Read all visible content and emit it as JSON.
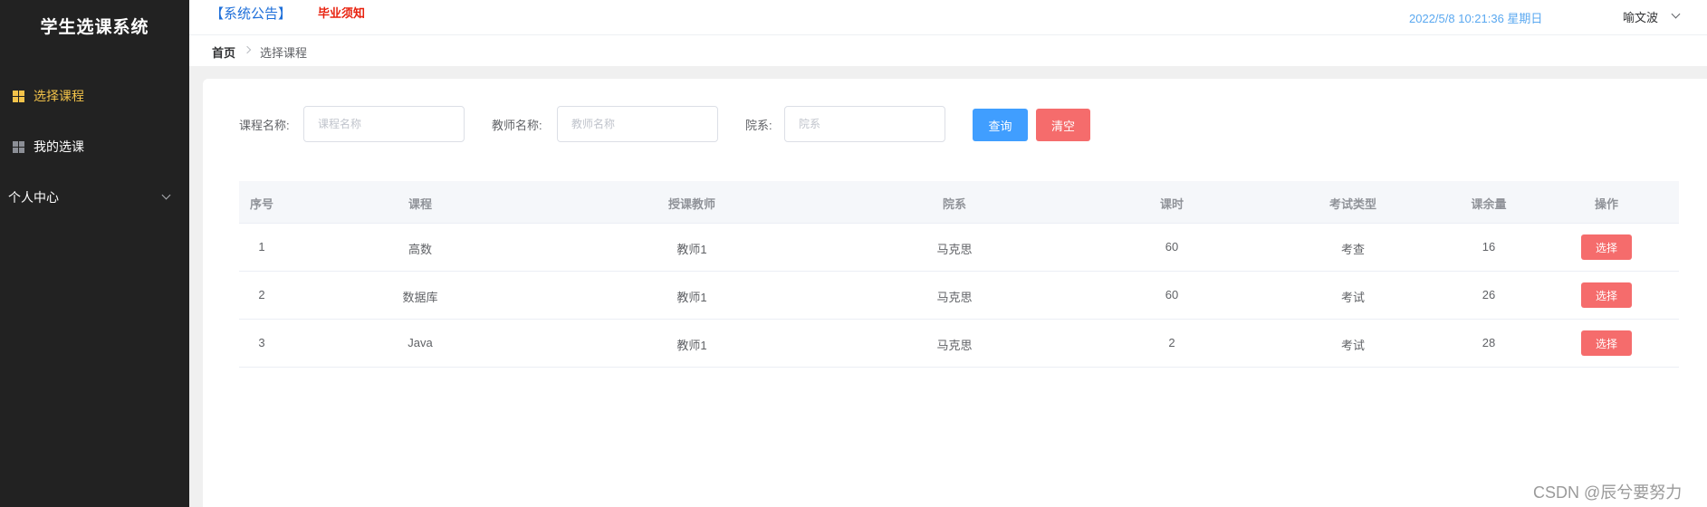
{
  "app": {
    "title": "学生选课系统"
  },
  "sidebar": {
    "items": [
      {
        "label": "选择课程",
        "icon": "grid-icon",
        "active": true
      },
      {
        "label": "我的选课",
        "icon": "grid-icon",
        "active": false
      },
      {
        "label": "个人中心",
        "icon": "chevron-down-icon",
        "active": false
      }
    ]
  },
  "header": {
    "notice": "【系统公告】",
    "grad_notice": "毕业须知",
    "datetime": "2022/5/8 10:21:36 星期日",
    "user": "喻文波"
  },
  "breadcrumb": {
    "home": "首页",
    "current": "选择课程"
  },
  "filters": {
    "course_label": "课程名称:",
    "course_placeholder": "课程名称",
    "course_value": "",
    "teacher_label": "教师名称:",
    "teacher_placeholder": "教师名称",
    "teacher_value": "",
    "dept_label": "院系:",
    "dept_placeholder": "院系",
    "dept_value": "",
    "query_label": "查询",
    "clear_label": "清空"
  },
  "table": {
    "headers": [
      "序号",
      "课程",
      "授课教师",
      "院系",
      "课时",
      "考试类型",
      "课余量",
      "操作"
    ],
    "rows": [
      {
        "no": "1",
        "course": "高数",
        "teacher": "教师1",
        "dept": "马克思",
        "hours": "60",
        "exam": "考查",
        "remain": "16",
        "action": "选择"
      },
      {
        "no": "2",
        "course": "数据库",
        "teacher": "教师1",
        "dept": "马克思",
        "hours": "60",
        "exam": "考试",
        "remain": "26",
        "action": "选择"
      },
      {
        "no": "3",
        "course": "Java",
        "teacher": "教师1",
        "dept": "马克思",
        "hours": "2",
        "exam": "考试",
        "remain": "28",
        "action": "选择"
      }
    ]
  },
  "watermark": "CSDN @辰兮要努力",
  "colors": {
    "sidebar_bg": "#222222",
    "active": "#f3c34a",
    "primary": "#409eff",
    "danger": "#f56c6c"
  }
}
